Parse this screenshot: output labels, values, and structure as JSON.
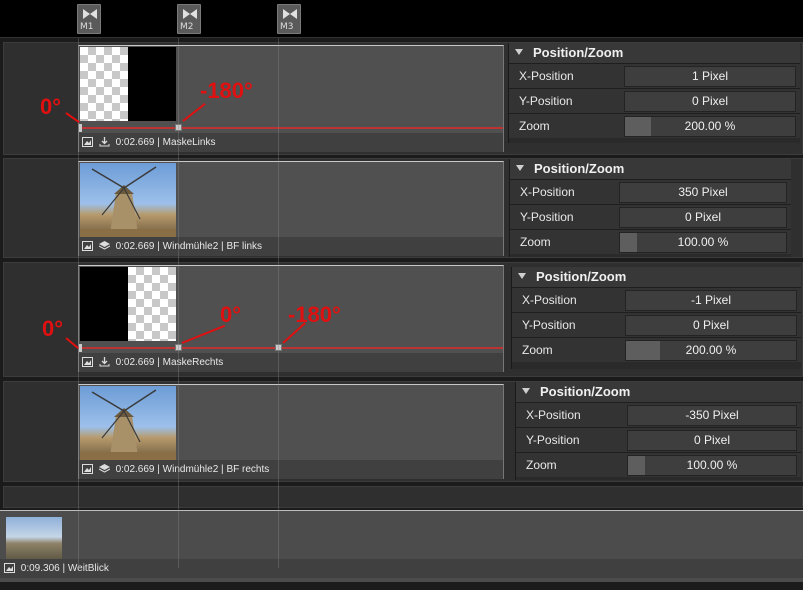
{
  "markers": [
    "M1",
    "M2",
    "M3"
  ],
  "panel_title": "Position/Zoom",
  "labels": {
    "x": "X-Position",
    "y": "Y-Position",
    "zoom": "Zoom"
  },
  "tracks": [
    {
      "duration": "0:02.669",
      "name": "MaskeLinks",
      "x": "1 Pixel",
      "y": "0 Pixel",
      "zoom": "200.00 %",
      "zoom_fraction": 0.15
    },
    {
      "duration": "0:02.669",
      "name": "Windmühle2",
      "sep": "|",
      "subname": "BF links",
      "x": "350 Pixel",
      "y": "0 Pixel",
      "zoom": "100.00 %",
      "zoom_fraction": 0.1
    },
    {
      "duration": "0:02.669",
      "name": "MaskeRechts",
      "x": "-1 Pixel",
      "y": "0 Pixel",
      "zoom": "200.00 %",
      "zoom_fraction": 0.2
    },
    {
      "duration": "0:02.669",
      "name": "Windmühle2",
      "sep": "|",
      "subname": "BF rechts",
      "x": "-350 Pixel",
      "y": "0 Pixel",
      "zoom": "100.00 %",
      "zoom_fraction": 0.1
    }
  ],
  "last_clip": {
    "duration": "0:09.306",
    "name": "WeitBlick"
  },
  "annotations": {
    "t1_start": "0°",
    "t1_end": "-180°",
    "t3_start": "0°",
    "t3_mid": "0°",
    "t3_end": "-180°"
  },
  "colors": {
    "keyline": "#b33333",
    "annotation": "#e01010",
    "background": "#1b1b1b"
  }
}
